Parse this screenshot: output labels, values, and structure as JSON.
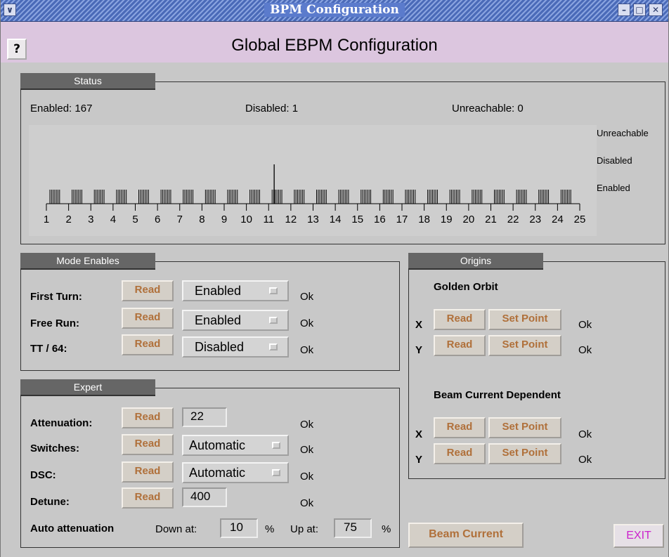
{
  "window": {
    "title": "BPM Configuration"
  },
  "header": {
    "help_label": "?",
    "title": "Global EBPM Configuration"
  },
  "status": {
    "label": "Status",
    "enabled_text": "Enabled:  167",
    "disabled_text": "Disabled: 1",
    "unreachable_text": "Unreachable:  0",
    "levels": [
      "Unreachable",
      "Disabled",
      "Enabled"
    ],
    "axis_labels": [
      "1",
      "2",
      "3",
      "4",
      "5",
      "6",
      "7",
      "8",
      "9",
      "10",
      "11",
      "12",
      "13",
      "14",
      "15",
      "16",
      "17",
      "18",
      "19",
      "20",
      "21",
      "22",
      "23",
      "24",
      "25"
    ],
    "disabled_position": 11.25,
    "chart_data": {
      "type": "bar",
      "title": "",
      "x_range": [
        1,
        25
      ],
      "levels": [
        "Enabled",
        "Disabled",
        "Unreachable"
      ],
      "enabled_count": 167,
      "disabled_count": 1,
      "unreachable_count": 0
    }
  },
  "mode": {
    "label": "Mode Enables",
    "rows": [
      {
        "name": "First Turn:",
        "read": "Read",
        "state": "Enabled",
        "status": "Ok"
      },
      {
        "name": "Free Run:",
        "read": "Read",
        "state": "Enabled",
        "status": "Ok"
      },
      {
        "name": "TT / 64:",
        "read": "Read",
        "state": "Disabled",
        "status": "Ok"
      }
    ]
  },
  "expert": {
    "label": "Expert",
    "rows": [
      {
        "name": "Attenuation:",
        "read": "Read",
        "value": "22",
        "status": "Ok"
      },
      {
        "name": "Switches:",
        "read": "Read",
        "value": "Automatic",
        "status": "Ok"
      },
      {
        "name": "DSC:",
        "read": "Read",
        "value": "Automatic",
        "status": "Ok"
      },
      {
        "name": "Detune:",
        "read": "Read",
        "value": "400",
        "status": "Ok"
      }
    ],
    "auto_att_label": "Auto attenuation",
    "down_label": "Down at:",
    "down_value": "10",
    "up_label": "Up at:",
    "up_value": "75",
    "percent": "%"
  },
  "origins": {
    "label": "Origins",
    "golden_title": "Golden Orbit",
    "beam_title": "Beam Current Dependent",
    "golden": [
      {
        "axis": "X",
        "read": "Read",
        "set": "Set Point",
        "status": "Ok"
      },
      {
        "axis": "Y",
        "read": "Read",
        "set": "Set Point",
        "status": "Ok"
      }
    ],
    "beam": [
      {
        "axis": "X",
        "read": "Read",
        "set": "Set Point",
        "status": "Ok"
      },
      {
        "axis": "Y",
        "read": "Read",
        "set": "Set Point",
        "status": "Ok"
      }
    ]
  },
  "footer": {
    "beam_current": "Beam Current",
    "exit": "EXIT"
  },
  "colors": {
    "read_text": "#b0703a",
    "exit_text": "#cc22cc",
    "header_bg": "#dcc6df"
  }
}
